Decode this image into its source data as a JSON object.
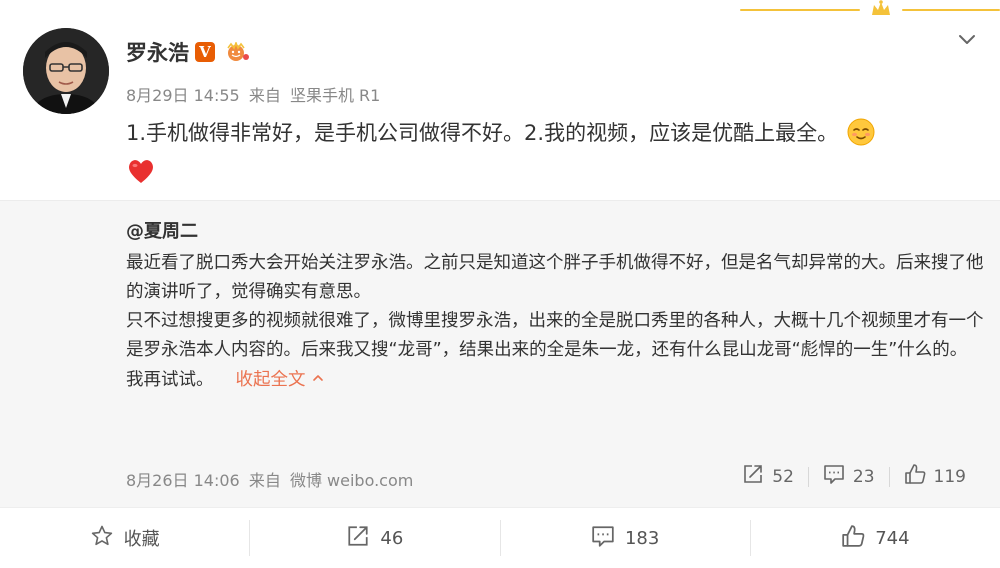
{
  "post": {
    "author": "罗永浩",
    "verified_badge": "V",
    "date": "8月29日 14:55",
    "from_prefix": "来自",
    "source": "坚果手机 R1",
    "text": "1.手机做得非常好，是手机公司做得不好。2.我的视频，应该是优酷上最全。"
  },
  "repost": {
    "author": "@夏周二",
    "paragraphs": [
      "最近看了脱口秀大会开始关注罗永浩。之前只是知道这个胖子手机做得不好，但是名气却异常的大。后来搜了他的演讲听了，觉得确实有意思。",
      "只不过想搜更多的视频就很难了，微博里搜罗永浩，出来的全是脱口秀里的各种人，大概十几个视频里才有一个是罗永浩本人内容的。后来我又搜“龙哥”，结果出来的全是朱一龙，还有什么昆山龙哥“彪悍的一生”什么的。"
    ],
    "last_line": "我再试试。",
    "collapse_label": "收起全文",
    "date": "8月26日 14:06",
    "from_prefix": "来自",
    "source": "微博 weibo.com",
    "reposts": "52",
    "comments": "23",
    "likes": "119"
  },
  "footer": {
    "favorite_label": "收藏",
    "reposts": "46",
    "comments": "183",
    "likes": "744"
  },
  "colors": {
    "accent": "#eb7350",
    "badge": "#e85d04",
    "repost_bg": "#f6f6f6"
  },
  "icons": [
    "crown-icon",
    "chevron-down-icon",
    "verified-icon",
    "member-icon",
    "smile-emoji-icon",
    "heart-emoji-icon",
    "repost-icon",
    "comment-icon",
    "like-icon",
    "star-icon"
  ]
}
